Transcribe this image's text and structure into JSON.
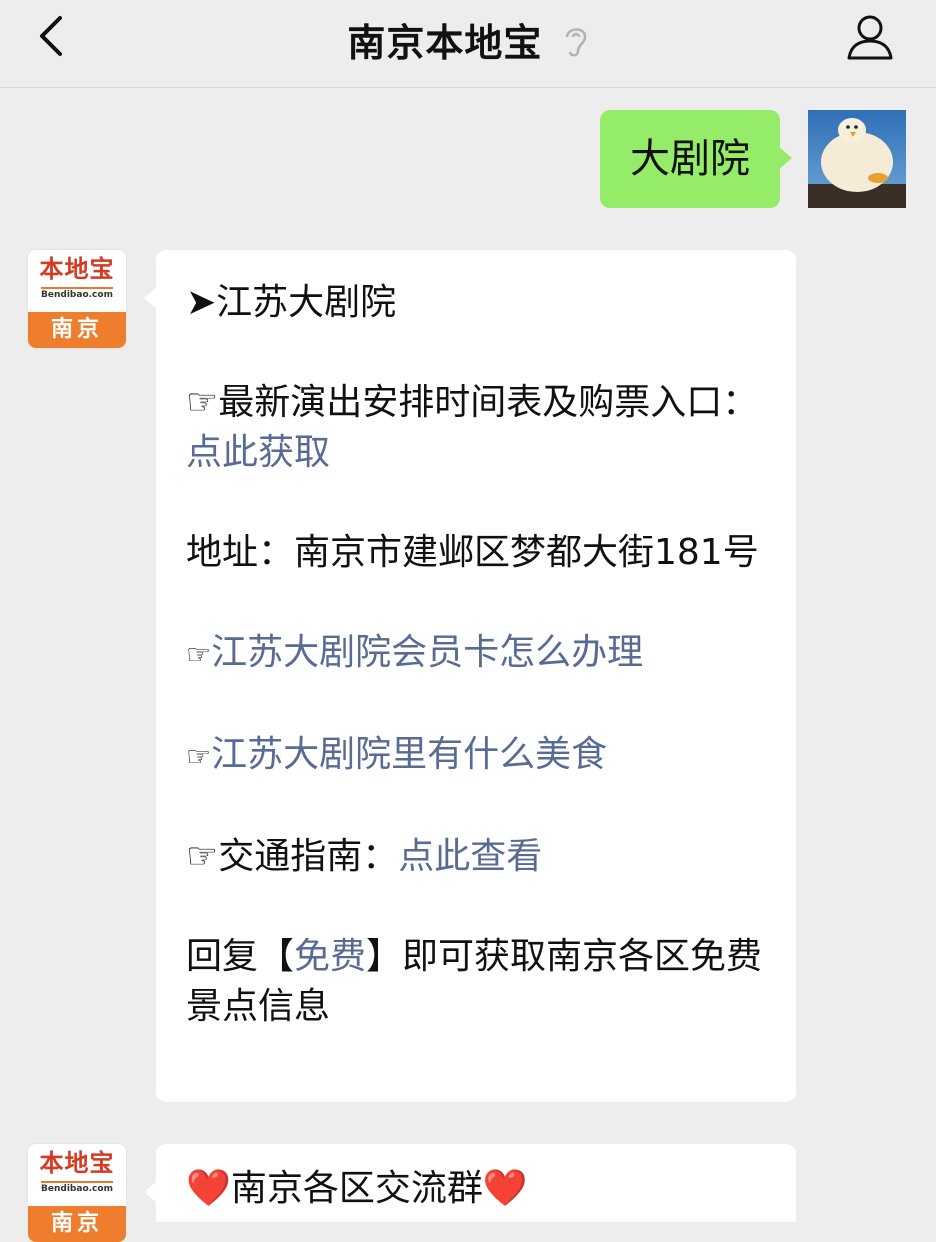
{
  "header": {
    "title": "南京本地宝",
    "back_icon": "chevron-left-icon",
    "ear_icon": "ear-icon",
    "profile_icon": "person-icon"
  },
  "messages": {
    "outgoing": {
      "text": "大剧院"
    },
    "reply": {
      "avatar_logo": "本地宝",
      "avatar_domain": "Bendibao.com",
      "avatar_city": "南京",
      "heading": "➤江苏大剧院",
      "schedule_prefix": "☞最新演出安排时间表及购票入口：",
      "schedule_link": "点此获取",
      "address": "地址：南京市建邺区梦都大街181号",
      "hand1": "☞",
      "membership_link": "江苏大剧院会员卡怎么办理",
      "hand2": "☞",
      "food_link": "江苏大剧院里有什么美食",
      "transport_prefix": "☞交通指南：",
      "transport_link": "点此查看",
      "free_prefix": "回复【",
      "free_keyword": "免费",
      "free_suffix": "】即可获取南京各区免费景点信息"
    },
    "second": {
      "avatar_logo": "本地宝",
      "avatar_domain": "Bendibao.com",
      "avatar_city": "南京",
      "text": "❤️南京各区交流群❤️"
    }
  },
  "colors": {
    "background": "#ededed",
    "outgoing_bubble": "#95ec69",
    "link": "#576b95",
    "logo_orange": "#ef7d2e",
    "logo_red": "#d53a20"
  }
}
